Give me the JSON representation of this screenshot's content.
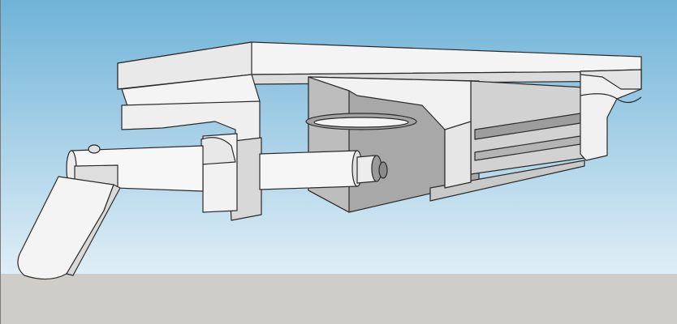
{
  "scene": {
    "type": "3d-model-viewport",
    "sky_top_color": "#6fb3d8",
    "sky_bottom_color": "#dfeef6",
    "ground_color": "#cfcdc8",
    "model_light_face": "#f4f4f4",
    "model_mid_face": "#d2d2d2",
    "model_shadow_face": "#a8a8a8",
    "edge_color": "#2a2a2a"
  }
}
